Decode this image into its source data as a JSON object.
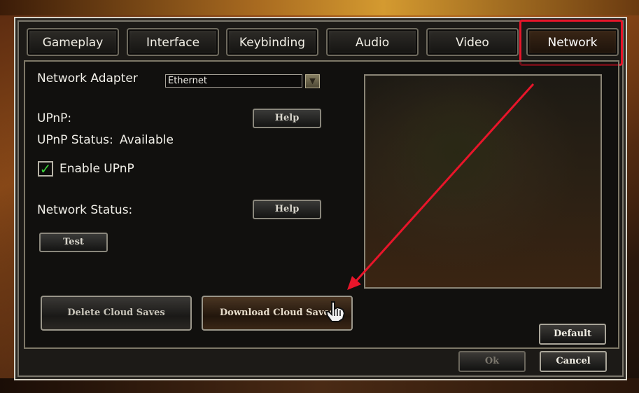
{
  "tabs": [
    {
      "label": "Gameplay"
    },
    {
      "label": "Interface"
    },
    {
      "label": "Keybinding"
    },
    {
      "label": "Audio"
    },
    {
      "label": "Video"
    },
    {
      "label": "Network"
    }
  ],
  "active_tab": "Network",
  "network": {
    "adapter_label": "Network Adapter",
    "adapter_value": "Ethernet",
    "upnp_label": "UPnP:",
    "upnp_status_label": "UPnP Status:",
    "upnp_status_value": "Available",
    "enable_upnp_label": "Enable UPnP",
    "enable_upnp_checked": true,
    "network_status_label": "Network Status:",
    "help_label": "Help",
    "test_label": "Test",
    "delete_cloud_label": "Delete Cloud Saves",
    "download_cloud_label": "Download Cloud Saves"
  },
  "footer": {
    "default_label": "Default",
    "ok_label": "Ok",
    "cancel_label": "Cancel"
  },
  "annotation_color": "#e8152a",
  "check_color": "#3ccf3a",
  "icons": [
    "dropdown-arrow-icon",
    "check-icon",
    "hand-cursor-icon"
  ]
}
